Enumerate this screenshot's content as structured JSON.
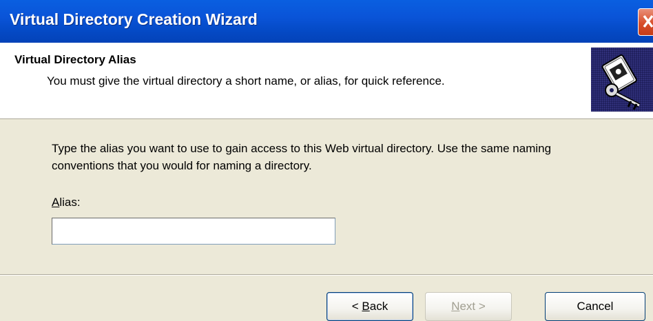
{
  "window": {
    "title": "Virtual Directory Creation Wizard",
    "close_icon": "close-icon"
  },
  "header": {
    "title": "Virtual Directory Alias",
    "subtitle": "You must give the virtual directory a short name, or alias, for quick reference.",
    "icon": "book-key-icon"
  },
  "main": {
    "instructions": "Type the alias you want to use to gain access to this Web virtual directory. Use the same naming conventions that you would for naming a directory.",
    "alias_label_mnemonic": "A",
    "alias_label_rest": "lias:",
    "alias_value": ""
  },
  "buttons": {
    "back_prefix": "< ",
    "back_mnemonic": "B",
    "back_rest": "ack",
    "next_mnemonic": "N",
    "next_rest": "ext >",
    "cancel": "Cancel"
  }
}
